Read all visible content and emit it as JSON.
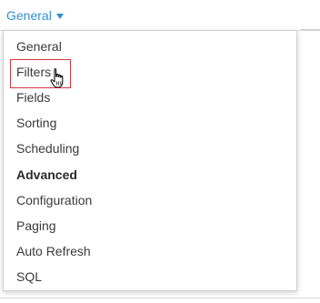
{
  "tab": {
    "label": "General",
    "icon": "chevron-down-icon",
    "color": "#2f8fd0"
  },
  "menu": {
    "items": [
      {
        "label": "General",
        "type": "item"
      },
      {
        "label": "Filters",
        "type": "item",
        "highlighted": true
      },
      {
        "label": "Fields",
        "type": "item"
      },
      {
        "label": "Sorting",
        "type": "item"
      },
      {
        "label": "Scheduling",
        "type": "item"
      },
      {
        "label": "Advanced",
        "type": "heading"
      },
      {
        "label": "Configuration",
        "type": "item"
      },
      {
        "label": "Paging",
        "type": "item"
      },
      {
        "label": "Auto Refresh",
        "type": "item"
      },
      {
        "label": "SQL",
        "type": "item"
      }
    ],
    "highlight_color": "#d9343d"
  },
  "cursor": {
    "icon": "hand-pointer-icon"
  }
}
